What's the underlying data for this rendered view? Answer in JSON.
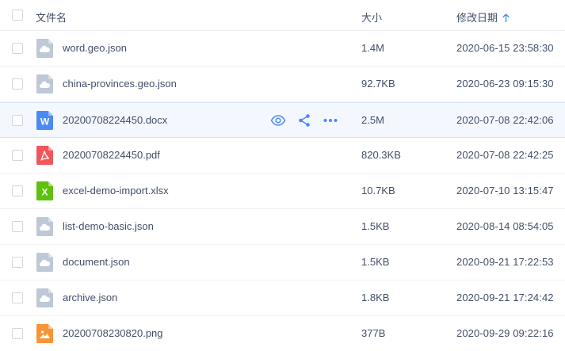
{
  "columns": {
    "name": "文件名",
    "size": "大小",
    "modified": "修改日期"
  },
  "sort": {
    "column": "modified",
    "direction": "ascending",
    "icon": "arrow-up-icon"
  },
  "colors": {
    "text": "#424e67",
    "generic": "#bec8d6",
    "word": "#4a8af4",
    "pdf": "#f0575a",
    "excel": "#5ec10b",
    "image": "#f79436",
    "action": "#4a8af4",
    "hover_bg": "#f4f7fe"
  },
  "files": [
    {
      "name": "word.geo.json",
      "size": "1.4M",
      "modified": "2020-06-15 23:58:30",
      "type": "generic",
      "icon": "cloud-file-icon"
    },
    {
      "name": "china-provinces.geo.json",
      "size": "92.7KB",
      "modified": "2020-06-23 09:15:30",
      "type": "generic",
      "icon": "cloud-file-icon"
    },
    {
      "name": "20200708224450.docx",
      "size": "2.5M",
      "modified": "2020-07-08 22:42:06",
      "type": "word",
      "icon": "word-file-icon",
      "icon_letter": "W",
      "hovered": true
    },
    {
      "name": "20200708224450.pdf",
      "size": "820.3KB",
      "modified": "2020-07-08 22:42:25",
      "type": "pdf",
      "icon": "pdf-file-icon"
    },
    {
      "name": "excel-demo-import.xlsx",
      "size": "10.7KB",
      "modified": "2020-07-10 13:15:47",
      "type": "excel",
      "icon": "excel-file-icon",
      "icon_letter": "X"
    },
    {
      "name": "list-demo-basic.json",
      "size": "1.5KB",
      "modified": "2020-08-14 08:54:05",
      "type": "generic",
      "icon": "cloud-file-icon"
    },
    {
      "name": "document.json",
      "size": "1.5KB",
      "modified": "2020-09-21 17:22:53",
      "type": "generic",
      "icon": "cloud-file-icon"
    },
    {
      "name": "archive.json",
      "size": "1.8KB",
      "modified": "2020-09-21 17:24:42",
      "type": "generic",
      "icon": "cloud-file-icon"
    },
    {
      "name": "20200708230820.png",
      "size": "377B",
      "modified": "2020-09-29 09:22:16",
      "type": "image",
      "icon": "image-file-icon"
    }
  ],
  "row_actions": [
    "preview-eye-icon",
    "share-icon",
    "more-dots-icon"
  ]
}
